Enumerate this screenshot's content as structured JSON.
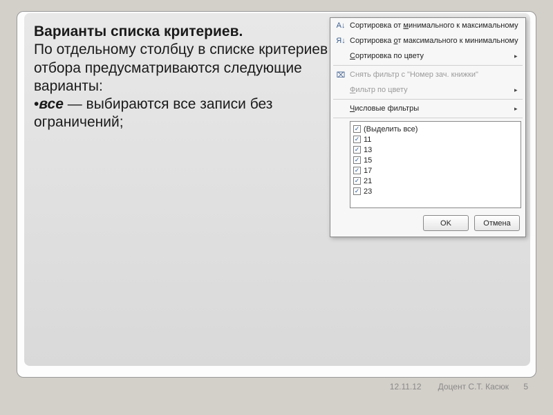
{
  "slide": {
    "title": "Варианты списка критериев.",
    "body1": "По отдельному столбцу в списке критериев отбора предусматриваются следующие варианты:",
    "bullet_mark": "•",
    "bullet_term": "все",
    "bullet_rest": " — выбираются все записи без ограничений;"
  },
  "filter": {
    "sort_asc_pre": "Сортировка от ",
    "sort_asc_u": "м",
    "sort_asc_post": "инимального к максимальному",
    "sort_desc_pre": "Сортировка ",
    "sort_desc_u": "о",
    "sort_desc_post": "т максимального к минимальному",
    "sort_color_u": "С",
    "sort_color_post": "ортировка по цвету",
    "clear_filter": "Снять фильтр с \"Номер зач. книжки\"",
    "filter_color_u": "Ф",
    "filter_color_post": "ильтр по цвету",
    "num_filters_u": "Ч",
    "num_filters_post": "исловые фильтры",
    "select_all": "(Выделить все)",
    "items": [
      "11",
      "13",
      "15",
      "17",
      "21",
      "23"
    ],
    "ok": "OK",
    "cancel": "Отмена",
    "icon_asc": "А↓",
    "icon_desc": "Я↓",
    "icon_clear": "⌧",
    "arrow": "▸"
  },
  "footer": {
    "date": "12.11.12",
    "author": "Доцент С.Т. Касюк",
    "page": "5"
  }
}
